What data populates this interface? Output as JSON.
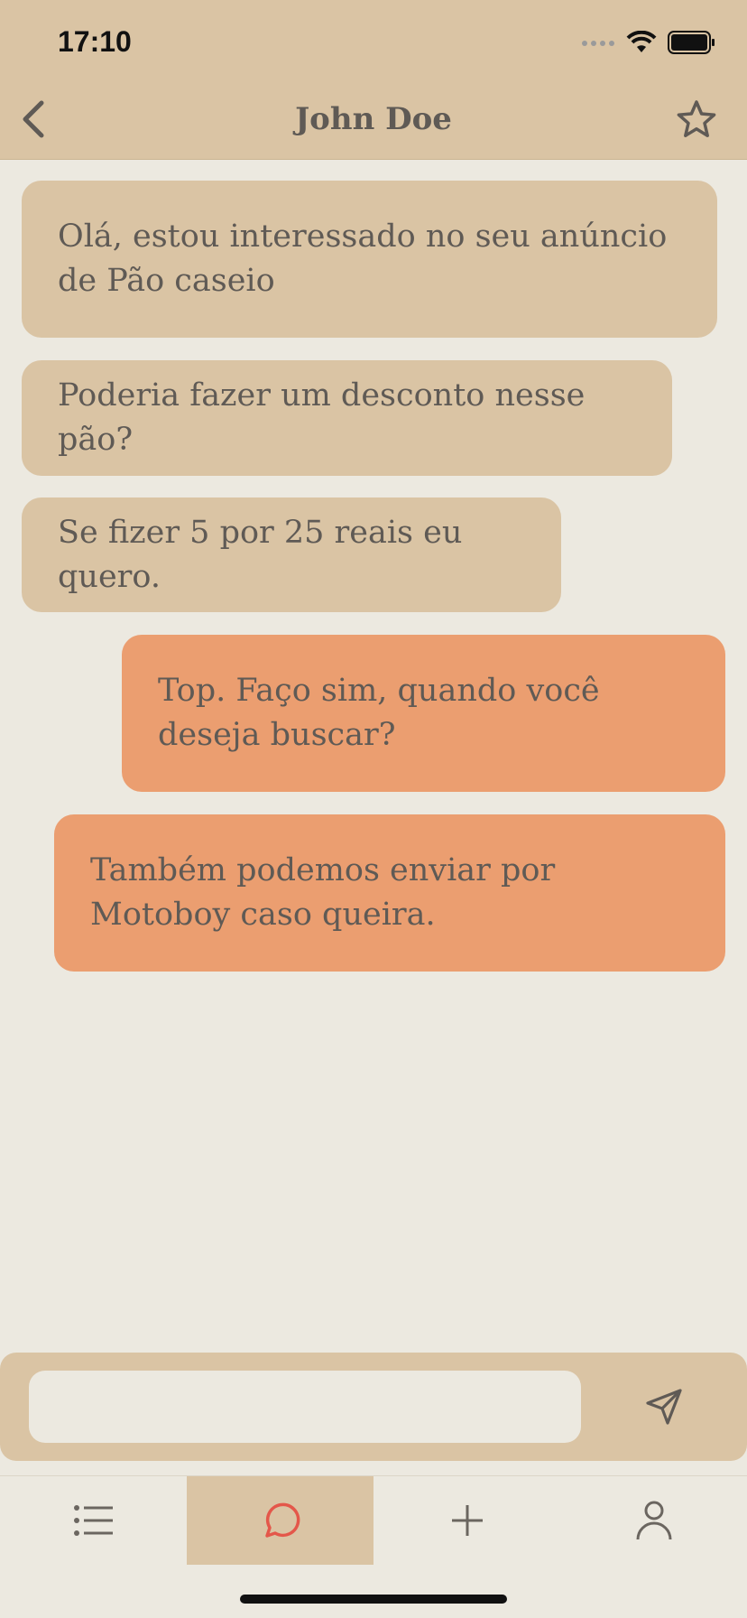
{
  "status_bar": {
    "time": "17:10"
  },
  "header": {
    "title": "John Doe"
  },
  "messages": [
    {
      "direction": "incoming",
      "text": "Olá, estou interessado no seu anúncio de Pão caseio"
    },
    {
      "direction": "incoming",
      "text": "Poderia fazer um desconto nesse pão?"
    },
    {
      "direction": "incoming",
      "text": "Se fizer 5 por 25 reais eu quero."
    },
    {
      "direction": "outgoing",
      "text": "Top. Faço sim, quando você deseja buscar?"
    },
    {
      "direction": "outgoing",
      "text": "Também podemos enviar por Motoboy caso queira."
    }
  ],
  "composer": {
    "value": "",
    "placeholder": ""
  },
  "tabs": [
    {
      "icon": "list-icon",
      "active": false
    },
    {
      "icon": "chat-bubble-icon",
      "active": true
    },
    {
      "icon": "plus-icon",
      "active": false
    },
    {
      "icon": "user-icon",
      "active": false
    }
  ],
  "colors": {
    "header_bg": "#DAC4A4",
    "page_bg": "#ECE9E0",
    "incoming_bubble": "#DAC4A4",
    "outgoing_bubble": "#EB9E70",
    "active_tab_icon": "#E4574A",
    "text": "#5f5a55"
  }
}
